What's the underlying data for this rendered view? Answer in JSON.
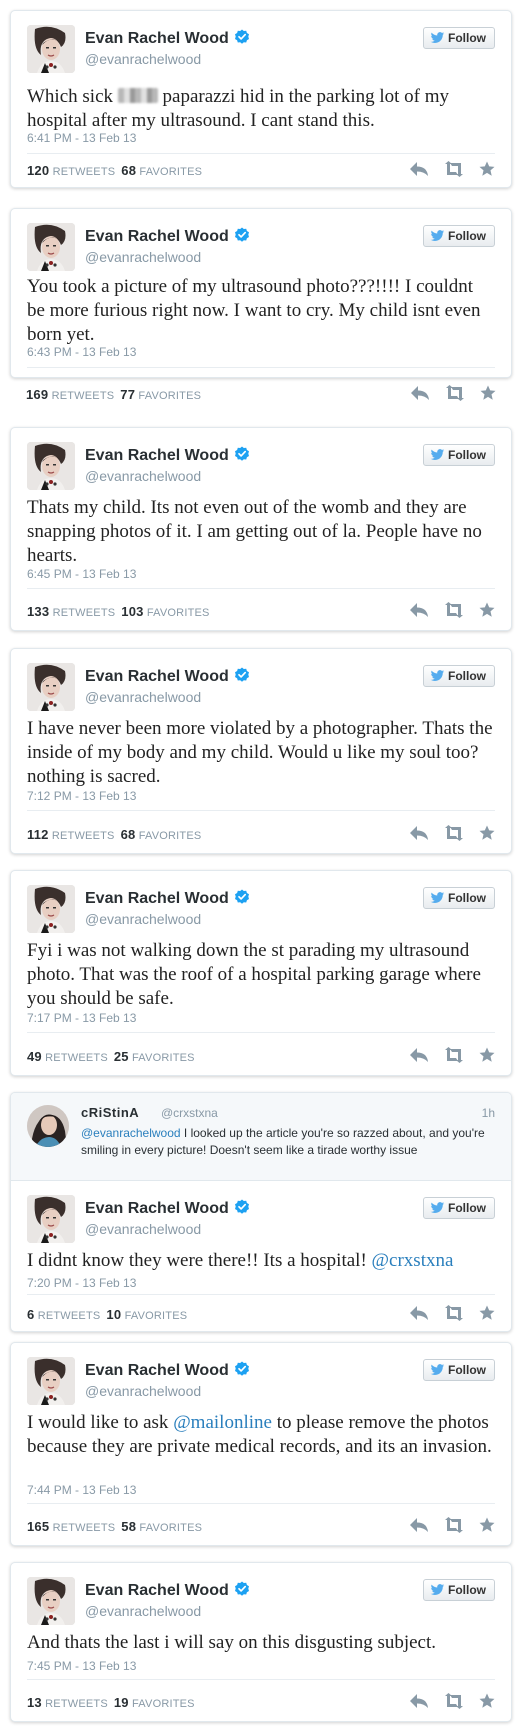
{
  "author": {
    "name": "Evan Rachel Wood",
    "handle": "@evanrachelwood",
    "follow_label": "Follow"
  },
  "labels": {
    "retweets": "RETWEETS",
    "favorites": "FAVORITES"
  },
  "colors": {
    "verified": "#1da1f2",
    "twitter_bird": "#55acee",
    "link": "#2a7fbd",
    "meta_gray": "#8899a6"
  },
  "icons": [
    "verified-badge-icon",
    "twitter-bird-icon",
    "reply-icon",
    "retweet-icon",
    "favorite-star-icon"
  ],
  "tweets": [
    {
      "text_before": "Which sick",
      "text_after": "paparazzi hid in the parking lot of my hospital after my ultrasound. I cant stand this.",
      "time": "6:41 PM - 13 Feb 13",
      "retweets": "120",
      "favorites": "68"
    },
    {
      "text": "You took a picture of my ultrasound photo???!!!! I couldnt be more furious right now. I want to cry. My child isnt even born yet.",
      "time": "6:43 PM - 13 Feb 13",
      "retweets": "169",
      "favorites": "77"
    },
    {
      "text": "Thats my child. Its not even out of the womb and they are snapping photos of it. I am getting out of la. People have no hearts.",
      "time": "6:45 PM - 13 Feb 13",
      "retweets": "133",
      "favorites": "103"
    },
    {
      "text": "I have never been more violated by a photographer. Thats the inside of my body and my child. Would u like my soul too? nothing is sacred.",
      "time": "7:12 PM - 13 Feb 13",
      "retweets": "112",
      "favorites": "68"
    },
    {
      "text": "Fyi i was not walking down the st parading my ultrasound photo. That was the roof of a hospital parking garage where you should be safe.",
      "time": "7:17 PM - 13 Feb 13",
      "retweets": "49",
      "favorites": "25"
    },
    {
      "in_reply_to": {
        "name": "cRiStinA",
        "handle": "@crxstxna",
        "time": "1h",
        "mention": "@evanrachelwood",
        "text": " I looked up the article you're so razzed about, and you're smiling in every picture! Doesn't seem like a tirade worthy issue"
      },
      "text": "I didnt know they were there!! Its a hospital!",
      "mention": "@crxstxna",
      "time": "7:20 PM - 13 Feb 13",
      "retweets": "6",
      "favorites": "10"
    },
    {
      "text_before": "I would like to ask",
      "mention": "@mailonline",
      "text_after": "to please remove the photos because they are private medical records, and its an invasion.",
      "time": "7:44 PM - 13 Feb 13",
      "retweets": "165",
      "favorites": "58"
    },
    {
      "text": "And thats the last i will say on this disgusting subject.",
      "time": "7:45 PM - 13 Feb 13",
      "retweets": "13",
      "favorites": "19"
    }
  ]
}
